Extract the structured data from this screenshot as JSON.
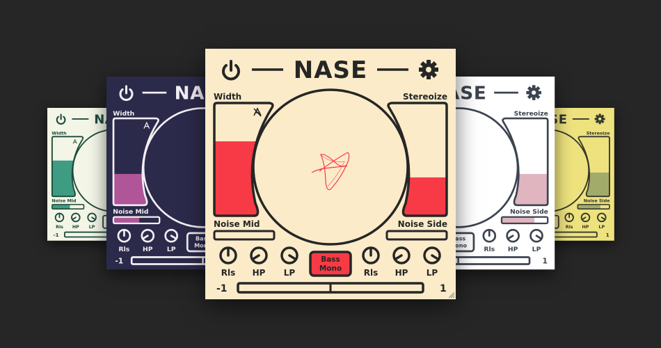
{
  "labels": {
    "title": "NASE",
    "width": "Width",
    "stereoize": "Stereoize",
    "noise_mid": "Noise Mid",
    "noise_side": "Noise Side",
    "rls": "Rls",
    "hp": "HP",
    "lp": "LP",
    "bass_mono_line1": "Bass",
    "bass_mono_line2": "Mono",
    "balance_min": "-1",
    "balance_max": "1"
  },
  "panels": [
    {
      "skin": "mint",
      "bg": "#f3f5e6",
      "fg": "#1d4a3c",
      "accent": "#3e9c82",
      "width_level": 0.6,
      "stereoize_level": 0.4,
      "noise_mid": 0.55,
      "noise_side": 0.55,
      "bass_mono_active": false,
      "auto_icon": "auto-icon",
      "scope": false
    },
    {
      "skin": "yellow",
      "bg": "#ede27e",
      "fg": "#34372c",
      "accent": "#a3ab6a",
      "width_level": 0.6,
      "stereoize_level": 0.4,
      "noise_mid": 0.7,
      "noise_side": 0.7,
      "bass_mono_active": false,
      "auto_icon": "auto-icon",
      "scope": false
    },
    {
      "skin": "purple",
      "bg": "#2c2a4a",
      "fg": "#f2eef4",
      "accent": "#b05598",
      "width_level": 0.36,
      "stereoize_level": 0.4,
      "noise_mid": 0.55,
      "noise_side": 0.55,
      "bass_mono_active": false,
      "auto_icon": "auto-icon",
      "scope": false
    },
    {
      "skin": "white",
      "bg": "#ffffff",
      "fg": "#3c4450",
      "accent": "#e0b5bf",
      "width_level": 0.36,
      "stereoize_level": 0.36,
      "noise_mid": 0.7,
      "noise_side": 0.7,
      "bass_mono_active": false,
      "auto_icon": "auto-icon",
      "scope": false
    },
    {
      "skin": "cream",
      "bg": "#fbebc9",
      "fg": "#262626",
      "accent": "#f73a45",
      "width_level": 0.66,
      "stereoize_level": 0.34,
      "noise_mid": 0,
      "noise_side": 0,
      "bass_mono_active": true,
      "auto_icon": "auto-off-icon",
      "scope": true
    }
  ],
  "knobs": {
    "rls": 0.5,
    "hp": 0.05,
    "lp": 0.95
  },
  "balance": 0.5
}
